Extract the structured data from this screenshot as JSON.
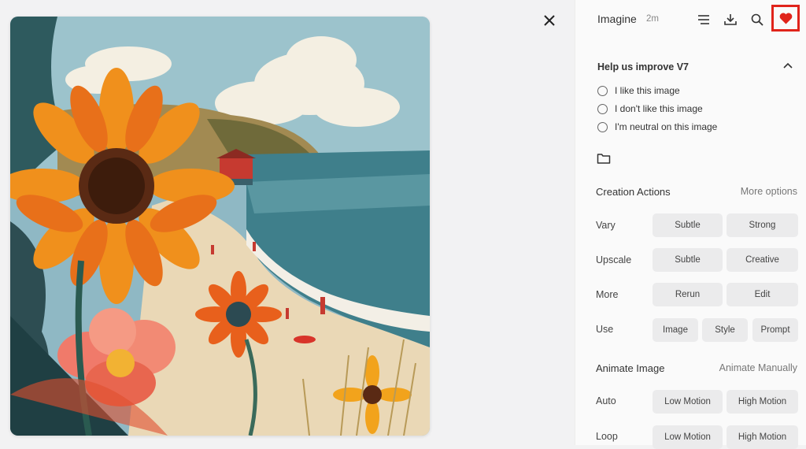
{
  "panel": {
    "title": "Imagine",
    "time": "2m"
  },
  "feedback": {
    "title": "Help us improve V7",
    "options": [
      "I like this image",
      "I don't like this image",
      "I'm neutral on this image"
    ]
  },
  "creation": {
    "title": "Creation Actions",
    "more_options": "More options",
    "rows": [
      {
        "label": "Vary",
        "buttons": [
          "Subtle",
          "Strong"
        ]
      },
      {
        "label": "Upscale",
        "buttons": [
          "Subtle",
          "Creative"
        ]
      },
      {
        "label": "More",
        "buttons": [
          "Rerun",
          "Edit"
        ]
      },
      {
        "label": "Use",
        "buttons": [
          "Image",
          "Style",
          "Prompt"
        ]
      }
    ]
  },
  "animate": {
    "title": "Animate Image",
    "manual": "Animate Manually",
    "rows": [
      {
        "label": "Auto",
        "buttons": [
          "Low Motion",
          "High Motion"
        ]
      },
      {
        "label": "Loop",
        "buttons": [
          "Low Motion",
          "High Motion"
        ]
      }
    ]
  },
  "colors": {
    "highlight": "#e0241b",
    "heart": "#e0241b"
  },
  "icons": [
    "close-icon",
    "menu-icon",
    "download-icon",
    "search-icon",
    "heart-icon",
    "chevron-up-icon",
    "folder-icon"
  ]
}
